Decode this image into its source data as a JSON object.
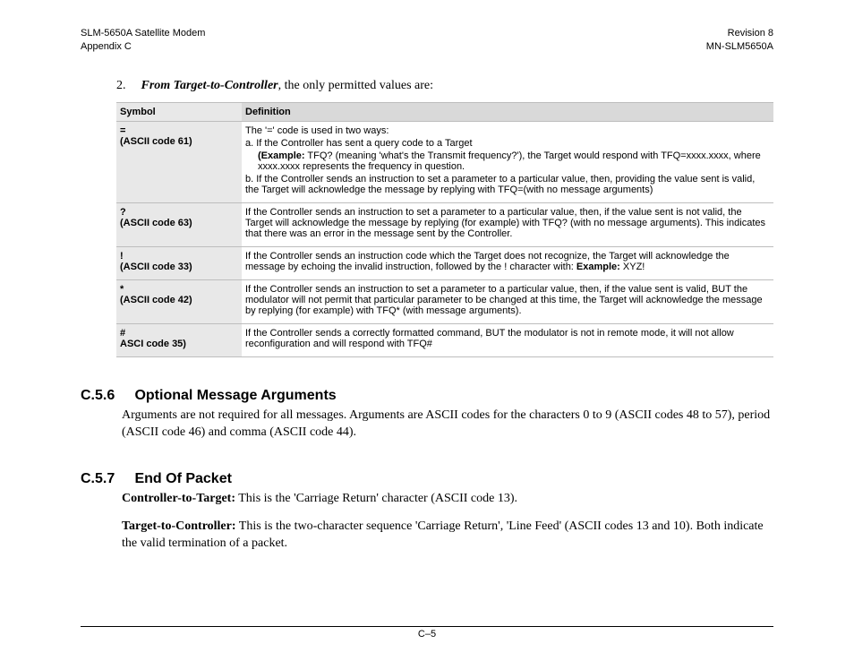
{
  "header": {
    "left_line1": "SLM-5650A Satellite Modem",
    "left_line2": "Appendix C",
    "right_line1": "Revision 8",
    "right_line2": "MN-SLM5650A"
  },
  "intro": {
    "number": "2.",
    "lead": "From Target-to-Controller",
    "rest": ", the only permitted values are:"
  },
  "table": {
    "headers": {
      "symbol": "Symbol",
      "definition": "Definition"
    },
    "rows": [
      {
        "symbol_line1": "=",
        "symbol_line2": "(ASCII code 61)",
        "def_lines": [
          "The '=' code is used in two ways:",
          "a. If the Controller has sent a query code to a Target"
        ],
        "def_sub_bold": "(Example:",
        "def_sub_rest": " TFQ? (meaning 'what's the Transmit frequency?'), the Target would respond with TFQ=xxxx.xxxx, where xxxx.xxxx represents the frequency in question.",
        "def_lines_after": [
          "b. If the Controller sends an instruction to set a parameter to a particular value, then, providing the value sent is valid, the Target will acknowledge the message by replying with TFQ=(with no message arguments)"
        ]
      },
      {
        "symbol_line1": "?",
        "symbol_line2": "(ASCII code 63)",
        "def_text": "If the Controller sends an instruction to set a parameter to a particular value, then, if the value sent is not valid, the Target will acknowledge the message by replying (for example) with TFQ? (with no message arguments). This indicates that there was an error in the message sent by the Controller."
      },
      {
        "symbol_line1": "!",
        "symbol_line2": "(ASCII code 33)",
        "def_text_pre": "If the Controller sends an instruction code which the Target does not recognize, the Target will acknowledge the message by echoing the invalid instruction, followed by the ! character with: ",
        "def_text_bold": "Example:",
        "def_text_post": " XYZ!"
      },
      {
        "symbol_line1": "*",
        "symbol_line2": "(ASCII code 42)",
        "def_text": "If the Controller sends an instruction to set a parameter to a particular value, then, if the value sent is valid, BUT the modulator will not permit that particular parameter to be changed at this time, the Target will acknowledge the message by replying (for example) with TFQ* (with message arguments)."
      },
      {
        "symbol_line1": "#",
        "symbol_line2": "ASCI code 35)",
        "def_text": "If the Controller sends a correctly formatted command, BUT the modulator is not in remote mode, it will not allow reconfiguration and will respond with TFQ#"
      }
    ]
  },
  "sections": [
    {
      "num": "C.5.6",
      "title": "Optional Message Arguments",
      "paras": [
        {
          "lead": "",
          "text": "Arguments are not required for all messages. Arguments are ASCII codes for the characters 0 to 9 (ASCII codes 48 to 57), period (ASCII code 46) and comma (ASCII code 44)."
        }
      ]
    },
    {
      "num": "C.5.7",
      "title": "End Of Packet",
      "paras": [
        {
          "lead": "Controller-to-Target:",
          "text": " This is the 'Carriage Return' character (ASCII code 13)."
        },
        {
          "lead": "Target-to-Controller:",
          "text": " This is the two-character sequence 'Carriage Return', 'Line Feed' (ASCII codes 13 and 10).  Both indicate the valid termination of a packet."
        }
      ]
    }
  ],
  "footer": {
    "page": "C–5"
  }
}
